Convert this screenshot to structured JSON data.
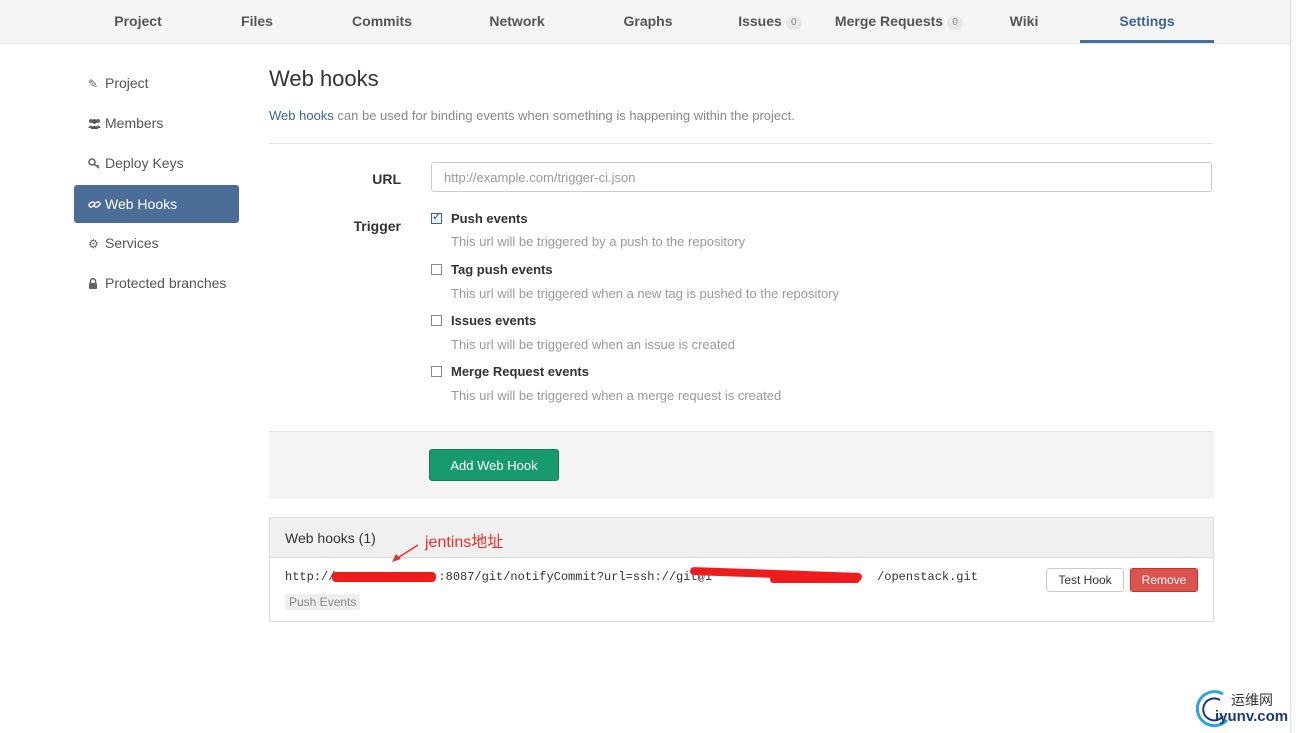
{
  "nav": {
    "tabs": [
      {
        "label": "Project"
      },
      {
        "label": "Files"
      },
      {
        "label": "Commits"
      },
      {
        "label": "Network"
      },
      {
        "label": "Graphs"
      },
      {
        "label": "Issues",
        "badge": "0"
      },
      {
        "label": "Merge Requests",
        "badge": "0"
      },
      {
        "label": "Wiki"
      },
      {
        "label": "Settings",
        "active": true
      }
    ]
  },
  "sidebar": {
    "items": [
      {
        "label": "Project",
        "icon": "edit-icon"
      },
      {
        "label": "Members",
        "icon": "users-icon"
      },
      {
        "label": "Deploy Keys",
        "icon": "key-icon"
      },
      {
        "label": "Web Hooks",
        "icon": "link-icon",
        "active": true
      },
      {
        "label": "Services",
        "icon": "cogs-icon"
      },
      {
        "label": "Protected branches",
        "icon": "lock-icon"
      }
    ]
  },
  "main": {
    "title": "Web hooks",
    "intro_link": "Web hooks",
    "intro_text": " can be used for binding events when something is happening within the project.",
    "url_label": "URL",
    "url_placeholder": "http://example.com/trigger-ci.json",
    "url_value": "",
    "trigger_label": "Trigger",
    "triggers": [
      {
        "label": "Push events",
        "help": "This url will be triggered by a push to the repository",
        "checked": true
      },
      {
        "label": "Tag push events",
        "help": "This url will be triggered when a new tag is pushed to the repository",
        "checked": false
      },
      {
        "label": "Issues events",
        "help": "This url will be triggered when an issue is created",
        "checked": false
      },
      {
        "label": "Merge Request events",
        "help": "This url will be triggered when a merge request is created",
        "checked": false
      }
    ],
    "add_button": "Add Web Hook"
  },
  "hooks_panel": {
    "title": "Web hooks (1)",
    "annotation": "jentins地址",
    "hooks": [
      {
        "url_part1": "http://",
        "url_part2": ":8087/git/notifyCommit?url=ssh://git@1",
        "url_part3": "/openstack.git",
        "tag": "Push Events",
        "test_label": "Test Hook",
        "remove_label": "Remove"
      }
    ]
  },
  "colors": {
    "accent": "#4b6e98",
    "success": "#169a6e",
    "danger": "#d9534f",
    "annotation": "#e8312f"
  },
  "watermark": {
    "line1": "运维网",
    "line2": "iyunv.com"
  }
}
